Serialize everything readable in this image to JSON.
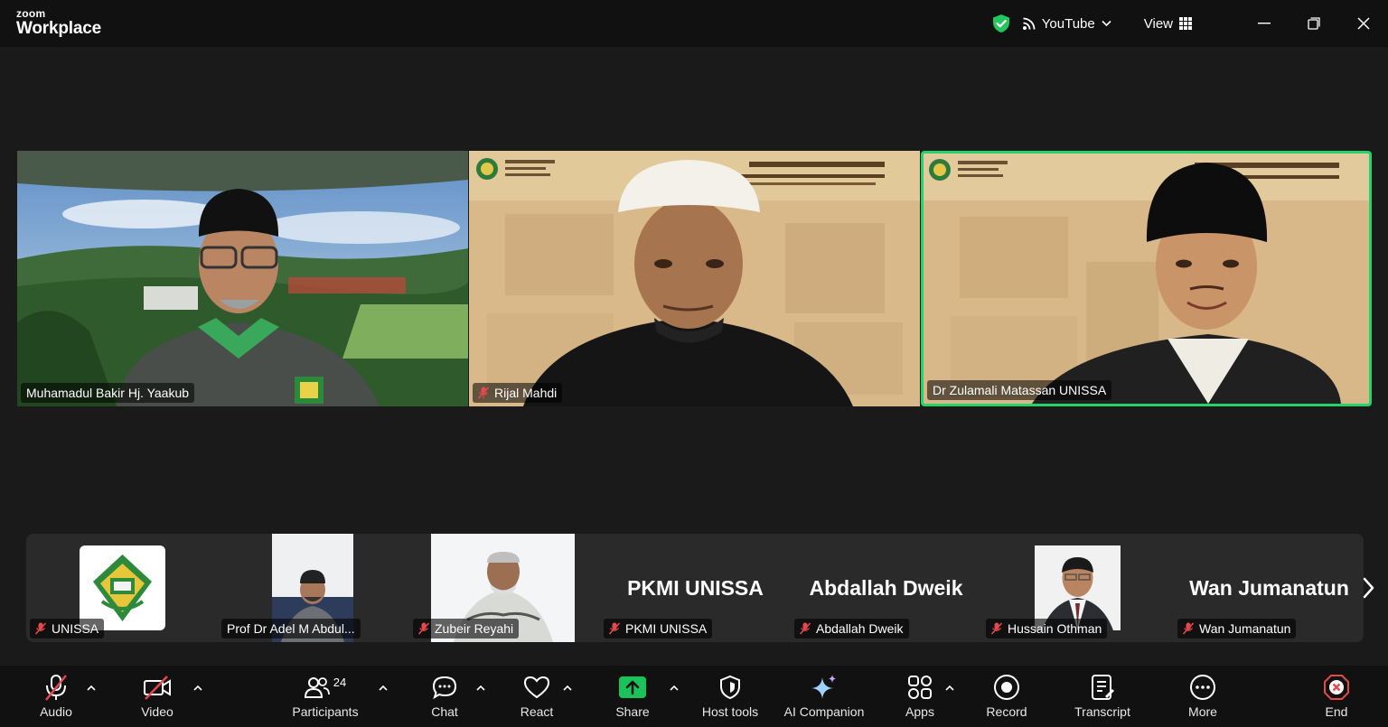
{
  "app": {
    "logo_small": "zoom",
    "logo_big": "Workplace"
  },
  "topbar": {
    "stream_label": "YouTube",
    "view_label": "View",
    "icons": [
      "shield-check-icon",
      "broadcast-icon",
      "chevron-down-icon",
      "grid-icon",
      "minimize-icon",
      "restore-icon",
      "close-icon"
    ]
  },
  "colors": {
    "active_speaker": "#22d46a",
    "muted": "#e5484d",
    "share": "#19c25a",
    "end": "#e5484d"
  },
  "gallery": [
    {
      "name": "Muhamadul Bakir Hj. Yaakub",
      "muted": false
    },
    {
      "name": "Rijal Mahdi",
      "muted": true
    },
    {
      "name": "Dr Zulamali Matassan UNISSA",
      "muted": false,
      "active": true
    }
  ],
  "filmstrip": [
    {
      "name": "UNISSA",
      "muted": true
    },
    {
      "name": "Prof Dr Adel M Abdul...",
      "muted": false
    },
    {
      "name": "Zubeir Reyahi",
      "muted": true
    },
    {
      "name": "PKMI UNISSA",
      "display": "PKMI UNISSA",
      "muted": true
    },
    {
      "name": "Abdallah Dweik",
      "display": "Abdallah Dweik",
      "muted": true
    },
    {
      "name": "Hussain Othman",
      "muted": true
    },
    {
      "name": "Wan Jumanatun",
      "display": "Wan Jumanatun",
      "muted": true
    }
  ],
  "toolbar": {
    "audio": "Audio",
    "video": "Video",
    "participants": "Participants",
    "participants_count": "24",
    "chat": "Chat",
    "react": "React",
    "share": "Share",
    "host_tools": "Host tools",
    "ai_companion": "AI Companion",
    "apps": "Apps",
    "record": "Record",
    "transcript": "Transcript",
    "more": "More",
    "end": "End"
  }
}
